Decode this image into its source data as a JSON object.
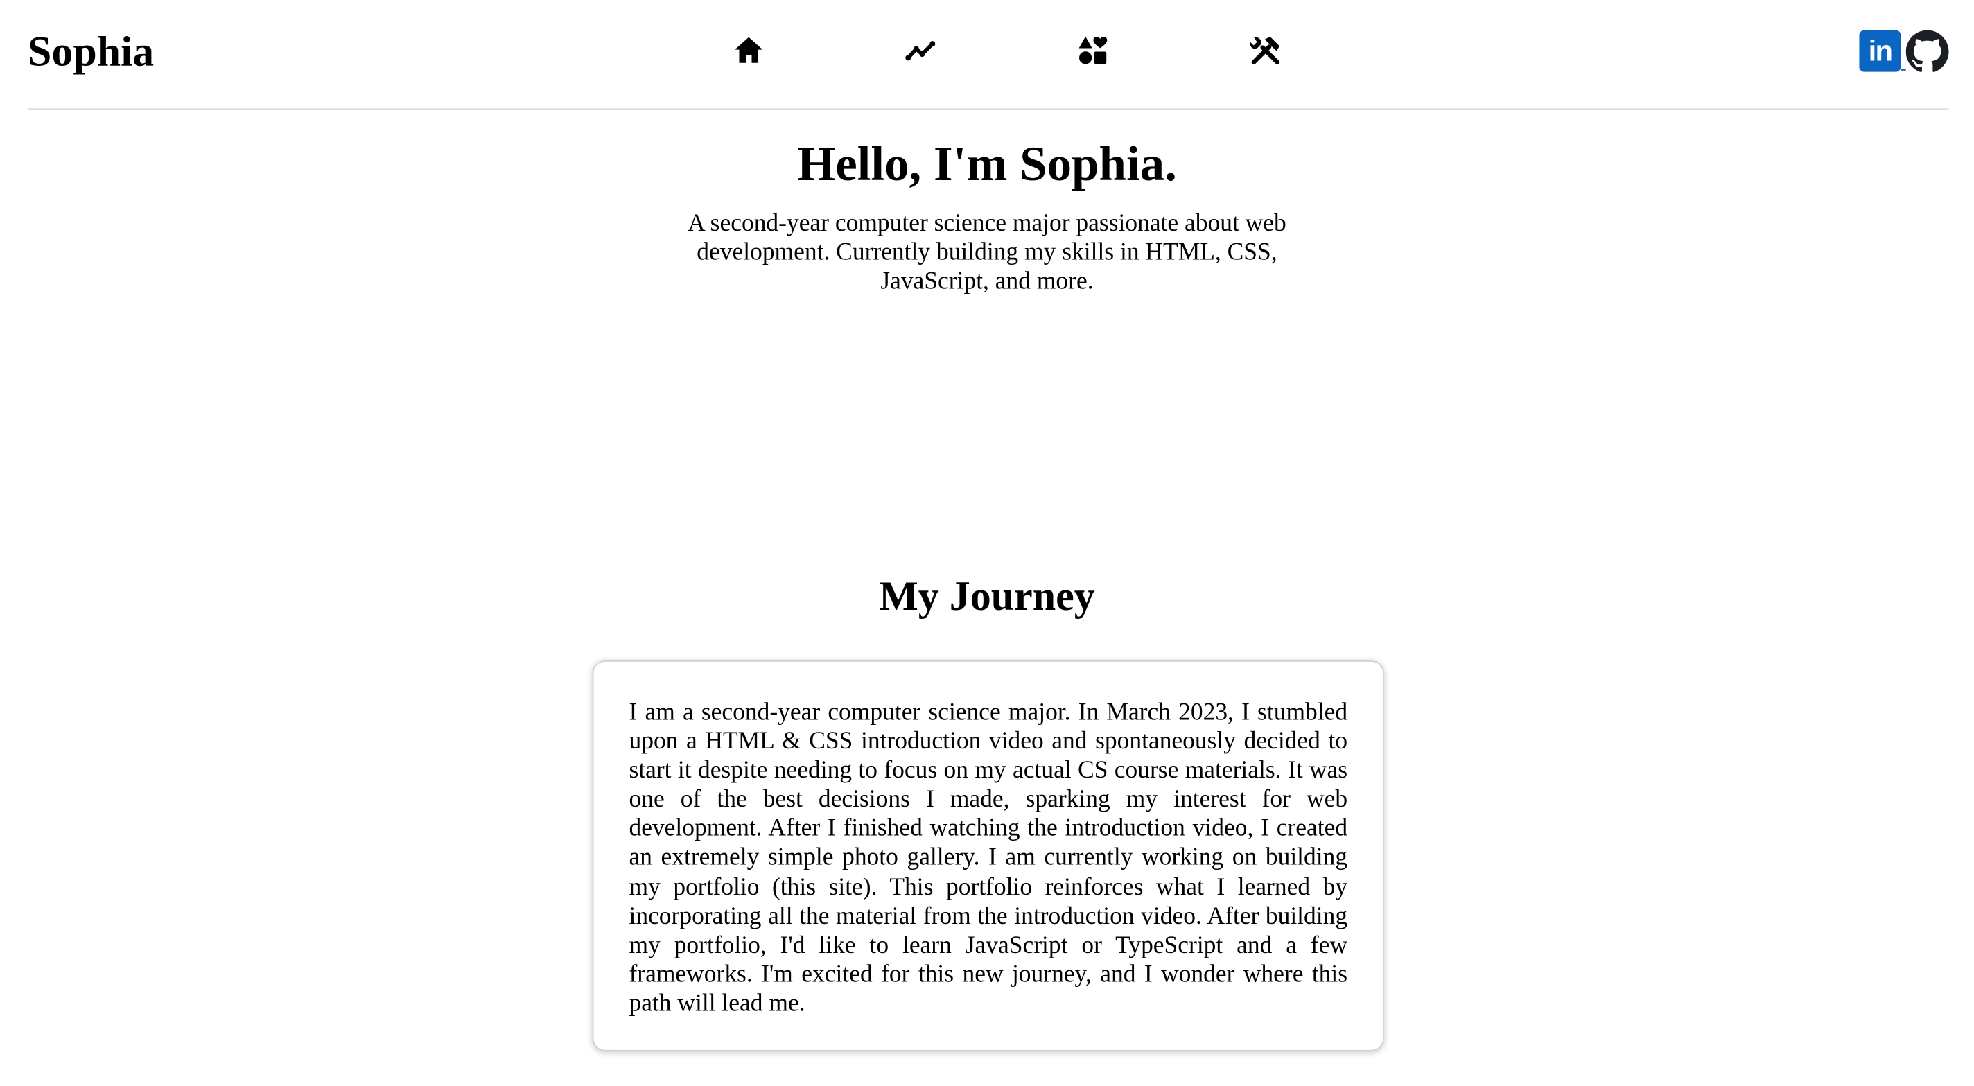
{
  "header": {
    "brand": "Sophia",
    "nav": [
      {
        "icon": "home-icon"
      },
      {
        "icon": "trending-icon"
      },
      {
        "icon": "shapes-icon"
      },
      {
        "icon": "tools-icon"
      }
    ],
    "social": {
      "linkedin_label": "in",
      "linkedin_color": "#0a66c2",
      "github_icon": "github-icon"
    }
  },
  "hero": {
    "title": "Hello, I'm Sophia.",
    "subtitle": "A second-year computer science major passionate about web development. Currently building my skills in HTML, CSS, JavaScript, and more."
  },
  "journey": {
    "title": "My Journey",
    "body": "I am a second-year computer science major. In March 2023, I stumbled upon a HTML & CSS introduction video and spontaneously decided to start it despite needing to focus on my actual CS course materials. It was one of the best decisions I made, sparking my interest for web development. After I finished watching the introduction video, I created an extremely simple photo gallery. I am currently working on building my portfolio (this site). This portfolio reinforces what I learned by incorporating all the material from the introduction video. After building my portfolio, I'd like to learn JavaScript or TypeScript and a few frameworks. I'm excited for this new journey, and I wonder where this path will lead me."
  }
}
